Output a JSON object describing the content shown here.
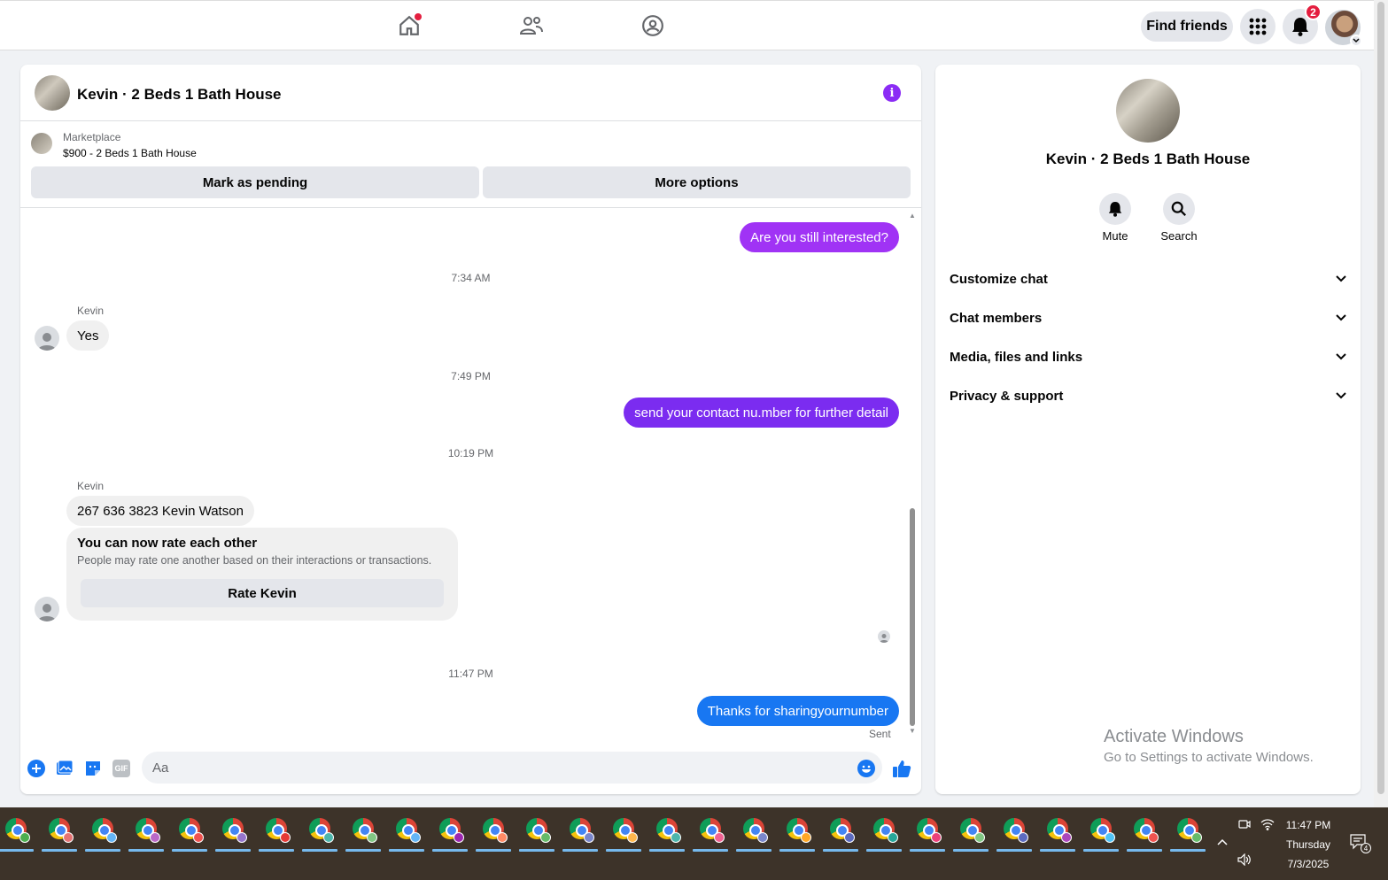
{
  "topnav": {
    "find_friends_label": "Find friends",
    "notification_count": "2",
    "icons": [
      "home-icon",
      "friends-icon",
      "groups-icon",
      "menu-grid-icon",
      "bell-icon"
    ]
  },
  "chat": {
    "title": "Kevin · 2 Beds 1 Bath House",
    "marketplace_label": "Marketplace",
    "listing": "$900 - 2 Beds 1 Bath House",
    "mark_pending_label": "Mark as pending",
    "more_options_label": "More options",
    "messages": {
      "out1": "Are you still interested?",
      "time1": "7:34 AM",
      "sender1": "Kevin",
      "in1": "Yes",
      "time2": "7:49 PM",
      "out2": "send your contact nu.mber for further detail",
      "time3": "10:19 PM",
      "sender2": "Kevin",
      "in2": "267 636 3823 Kevin Watson",
      "rate_title": "You can now rate each other",
      "rate_desc": "People may rate one another based on their interactions or transactions.",
      "rate_button": "Rate Kevin",
      "time4": "11:47 PM",
      "out3": "Thanks for sharingyournumber",
      "status": "Sent"
    },
    "composer_placeholder": "Aa",
    "gif_label": "GIF",
    "colors": {
      "purple": "#a033f5",
      "violet": "#7b2cf0",
      "blue": "#1877f2"
    }
  },
  "info_panel": {
    "name": "Kevin · 2 Beds 1 Bath House",
    "mute_label": "Mute",
    "search_label": "Search",
    "sections": [
      "Customize chat",
      "Chat members",
      "Media, files and links",
      "Privacy & support"
    ],
    "watermark_title": "Activate Windows",
    "watermark_sub": "Go to Settings to activate Windows."
  },
  "taskbar": {
    "time": "11:47 PM",
    "day": "Thursday",
    "date": "7/3/2025",
    "action_center_count": "4"
  }
}
